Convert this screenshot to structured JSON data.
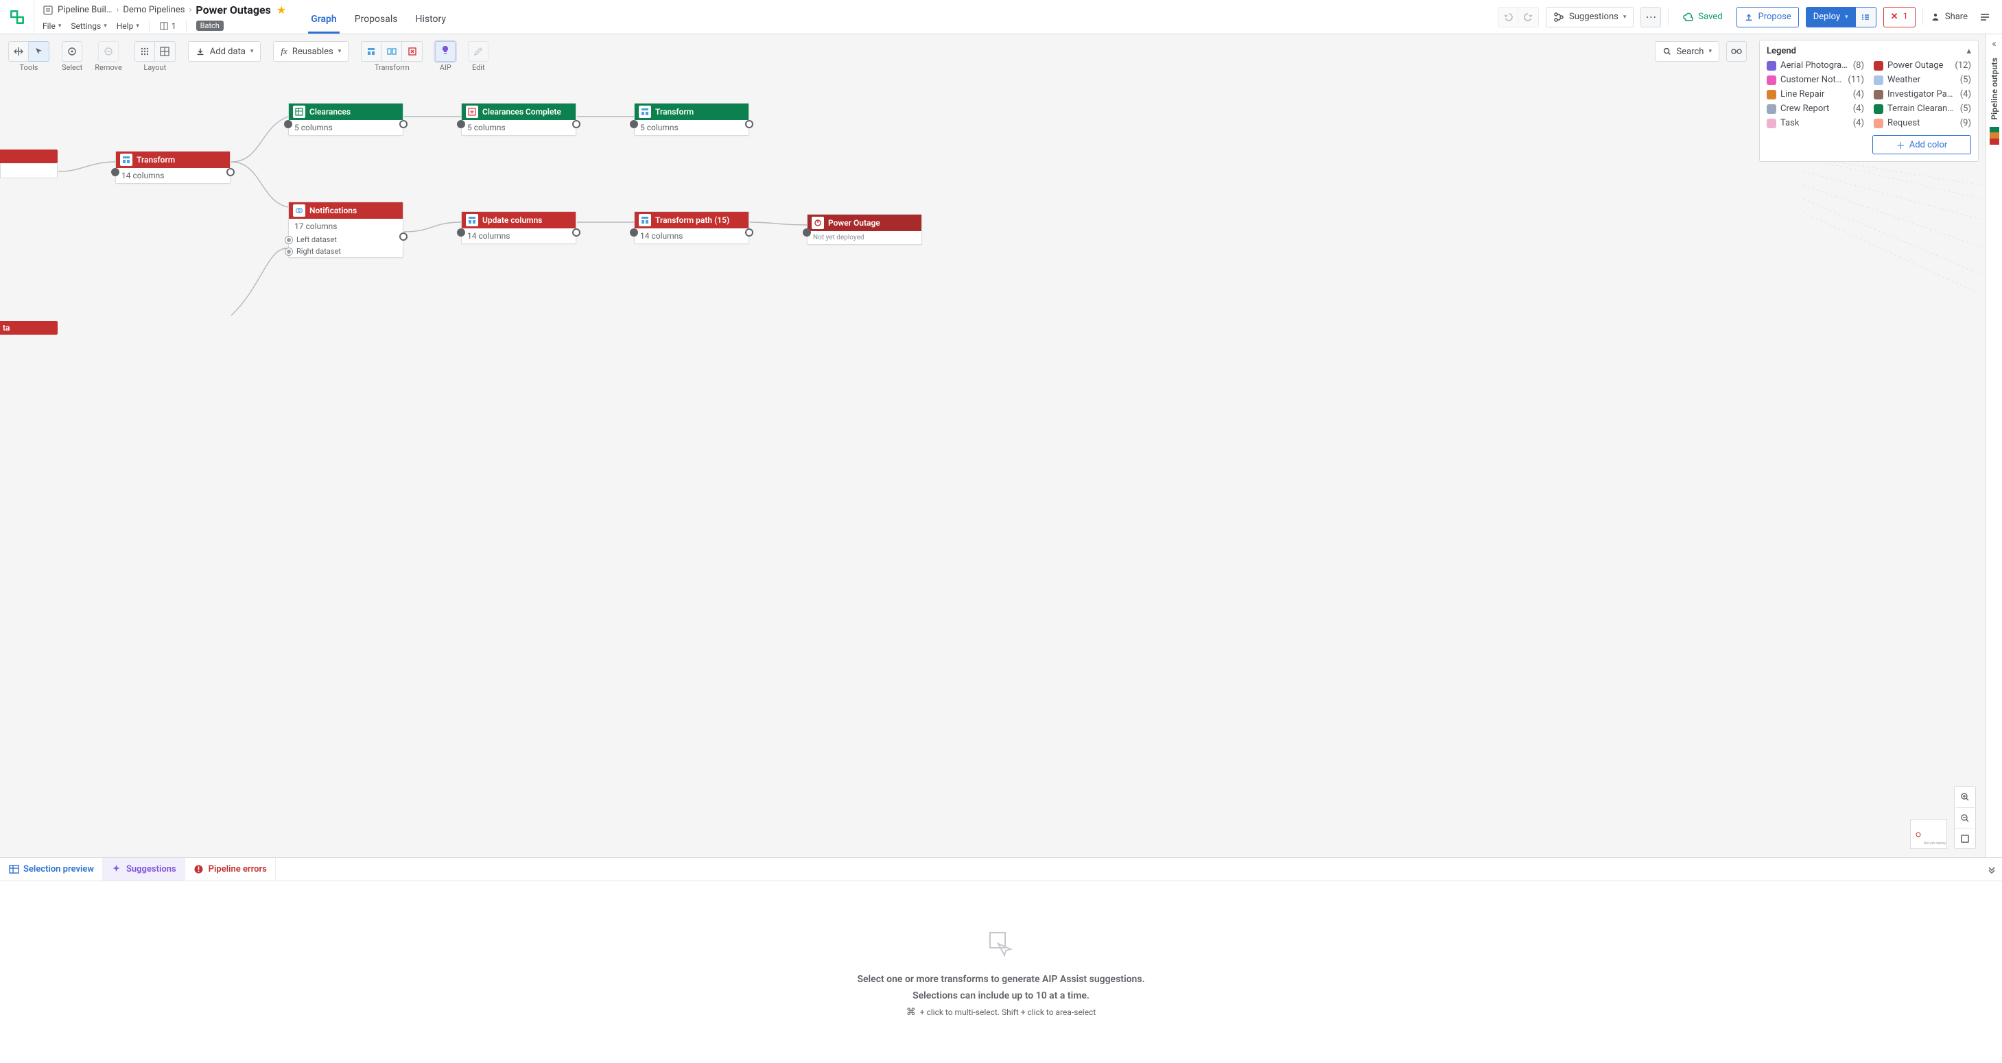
{
  "breadcrumb": {
    "app": "Pipeline Buil…",
    "folder": "Demo Pipelines",
    "current": "Power Outages"
  },
  "menus": {
    "file": "File",
    "settings": "Settings",
    "help": "Help",
    "user_count": "1",
    "mode_badge": "Batch"
  },
  "top_tabs": {
    "graph": "Graph",
    "proposals": "Proposals",
    "history": "History"
  },
  "top_actions": {
    "suggestions": "Suggestions",
    "saved": "Saved",
    "propose": "Propose",
    "deploy": "Deploy",
    "error_count": "1",
    "share": "Share"
  },
  "toolbar": {
    "tools_label": "Tools",
    "select_label": "Select",
    "remove_label": "Remove",
    "layout_label": "Layout",
    "add_data": "Add data",
    "reusables": "Reusables",
    "transform_label": "Transform",
    "aip_label": "AIP",
    "edit_label": "Edit"
  },
  "search": {
    "label": "Search"
  },
  "legend": {
    "title": "Legend",
    "add_color": "Add color",
    "items": [
      {
        "label": "Aerial Photography",
        "count": "(8)",
        "color": "#7961db"
      },
      {
        "label": "Power Outage",
        "count": "(12)",
        "color": "#c23030"
      },
      {
        "label": "Customer Notifi…",
        "count": "(11)",
        "color": "#eb5bba"
      },
      {
        "label": "Weather",
        "count": "(5)",
        "color": "#a8c5e8"
      },
      {
        "label": "Line Repair",
        "count": "(4)",
        "color": "#d9822b"
      },
      {
        "label": "Investigator Page",
        "count": "(4)",
        "color": "#8f6a5f"
      },
      {
        "label": "Crew Report",
        "count": "(4)",
        "color": "#9aa7bf"
      },
      {
        "label": "Terrain Clearance",
        "count": "(5)",
        "color": "#0d8050"
      },
      {
        "label": "Task",
        "count": "(4)",
        "color": "#f2b0cf"
      },
      {
        "label": "Request",
        "count": "(9)",
        "color": "#f9a28b"
      }
    ]
  },
  "side_rail": {
    "label": "Pipeline outputs"
  },
  "nodes": {
    "transform1": {
      "title": "Transform",
      "sub": "14 columns"
    },
    "clearances": {
      "title": "Clearances",
      "sub": "5 columns"
    },
    "clearances_complete": {
      "title": "Clearances Complete",
      "sub": "5 columns"
    },
    "transform_g": {
      "title": "Transform",
      "sub": "5 columns"
    },
    "notifications": {
      "title": "Notifications",
      "sub": "17 columns",
      "left": "Left dataset",
      "right": "Right dataset"
    },
    "update_cols": {
      "title": "Update columns",
      "sub": "14 columns"
    },
    "transform_path": {
      "title": "Transform path (15)",
      "sub": "14 columns"
    },
    "power_outage": {
      "title": "Power Outage",
      "sub": "Not yet deployed"
    },
    "peek_bottom": {
      "title": "ta"
    }
  },
  "bottom_tabs": {
    "selection_preview": "Selection preview",
    "suggestions": "Suggestions",
    "pipeline_errors": "Pipeline errors"
  },
  "bottom_body": {
    "line1": "Select one or more transforms to generate AIP Assist suggestions.",
    "line2": "Selections can include up to 10 at a time.",
    "hint": "+ click to multi-select. Shift + click to area-select"
  }
}
